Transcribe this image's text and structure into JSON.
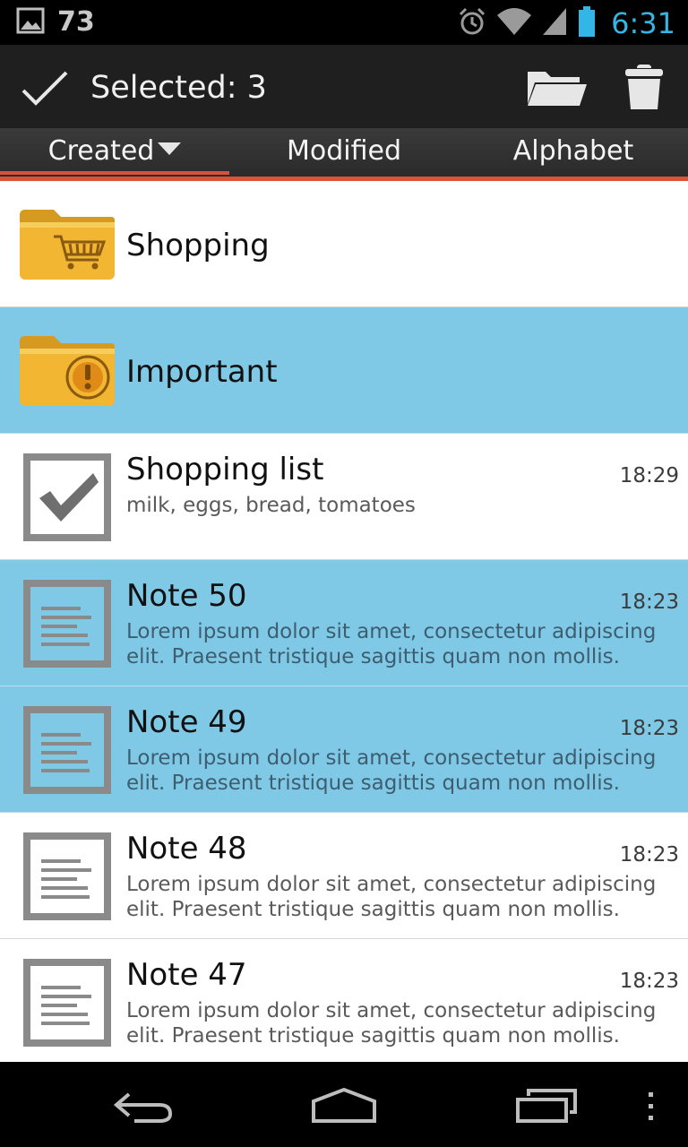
{
  "status_bar": {
    "notification_count": "73",
    "time": "6:31",
    "icons": [
      "image-notification-icon",
      "alarm-icon",
      "wifi-icon",
      "signal-icon",
      "battery-icon"
    ]
  },
  "action_bar": {
    "title": "Selected: 3",
    "icons": [
      "check-icon",
      "folder-icon",
      "trash-icon"
    ]
  },
  "tabs": [
    {
      "label": "Created",
      "active": true
    },
    {
      "label": "Modified",
      "active": false
    },
    {
      "label": "Alphabet",
      "active": false
    }
  ],
  "items": [
    {
      "type": "folder",
      "name": "Shopping",
      "icon": "shopping-cart-folder-icon",
      "selected": false
    },
    {
      "type": "folder",
      "name": "Important",
      "icon": "important-folder-icon",
      "selected": true
    },
    {
      "type": "note",
      "kind": "checklist",
      "title": "Shopping list",
      "time": "18:29",
      "body": "milk, eggs, bread, tomatoes",
      "selected": false
    },
    {
      "type": "note",
      "kind": "text",
      "title": "Note 50",
      "time": "18:23",
      "body": "Lorem ipsum dolor sit amet, consectetur adipiscing elit. Praesent tristique sagittis quam non mollis.",
      "selected": true
    },
    {
      "type": "note",
      "kind": "text",
      "title": "Note 49",
      "time": "18:23",
      "body": "Lorem ipsum dolor sit amet, consectetur adipiscing elit. Praesent tristique sagittis quam non mollis.",
      "selected": true
    },
    {
      "type": "note",
      "kind": "text",
      "title": "Note 48",
      "time": "18:23",
      "body": "Lorem ipsum dolor sit amet, consectetur adipiscing elit. Praesent tristique sagittis quam non mollis.",
      "selected": false
    },
    {
      "type": "note",
      "kind": "text",
      "title": "Note 47",
      "time": "18:23",
      "body": "Lorem ipsum dolor sit amet, consectetur adipiscing elit. Praesent tristique sagittis quam non mollis.",
      "selected": false
    }
  ],
  "nav_bar": {
    "icons": [
      "back-icon",
      "home-icon",
      "recent-apps-icon",
      "overflow-menu-icon"
    ]
  },
  "colors": {
    "selection": "#7fc9e7",
    "accent": "#d9533b",
    "status_time": "#33b5e5",
    "folder": "#f2b632"
  }
}
